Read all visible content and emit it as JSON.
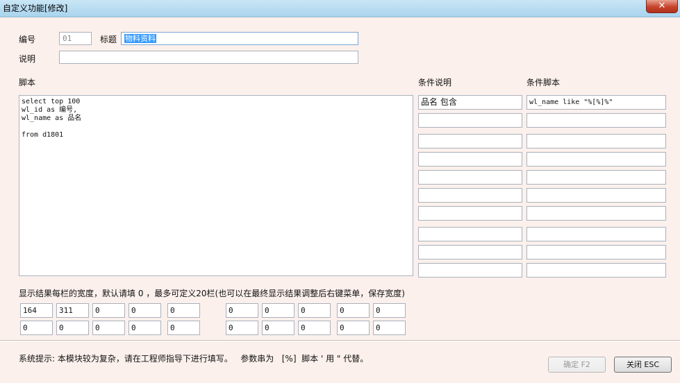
{
  "window": {
    "title": "自定义功能[修改]",
    "close_glyph": "✕"
  },
  "form": {
    "number_label": "编号",
    "number_value": "01",
    "title_label": "标题",
    "title_value": "物料资料",
    "desc_label": "说明",
    "desc_value": ""
  },
  "script": {
    "label": "脚本",
    "content": "select top 100\nwl_id as 编号,\nwl_name as 品名\n\nfrom d1801"
  },
  "conditions": {
    "desc_header": "条件说明",
    "script_header": "条件脚本",
    "rows": [
      {
        "desc": "品名 包含",
        "script": "wl_name like \"%[%]%\""
      },
      {
        "desc": "",
        "script": ""
      },
      {
        "desc": "",
        "script": ""
      },
      {
        "desc": "",
        "script": ""
      },
      {
        "desc": "",
        "script": ""
      },
      {
        "desc": "",
        "script": ""
      },
      {
        "desc": "",
        "script": ""
      },
      {
        "desc": "",
        "script": ""
      },
      {
        "desc": "",
        "script": ""
      },
      {
        "desc": "",
        "script": ""
      }
    ]
  },
  "widths": {
    "label": "显示结果每栏的宽度，默认请填 0 ，最多可定义20栏(也可以在最终显示结果调整后右键菜单，保存宽度)",
    "row1": [
      "164",
      "311",
      "0",
      "0",
      "0",
      "0",
      "0",
      "0",
      "0",
      "0"
    ],
    "row2": [
      "0",
      "0",
      "0",
      "0",
      "0",
      "0",
      "0",
      "0",
      "0",
      "0"
    ]
  },
  "footer": {
    "hint": "系统提示: 本模块较为复杂，请在工程师指导下进行填写。   参数串为   [%]  脚本 ' 用 \" 代替。",
    "confirm_label": "确定 F2",
    "close_label": "关闭 ESC"
  }
}
